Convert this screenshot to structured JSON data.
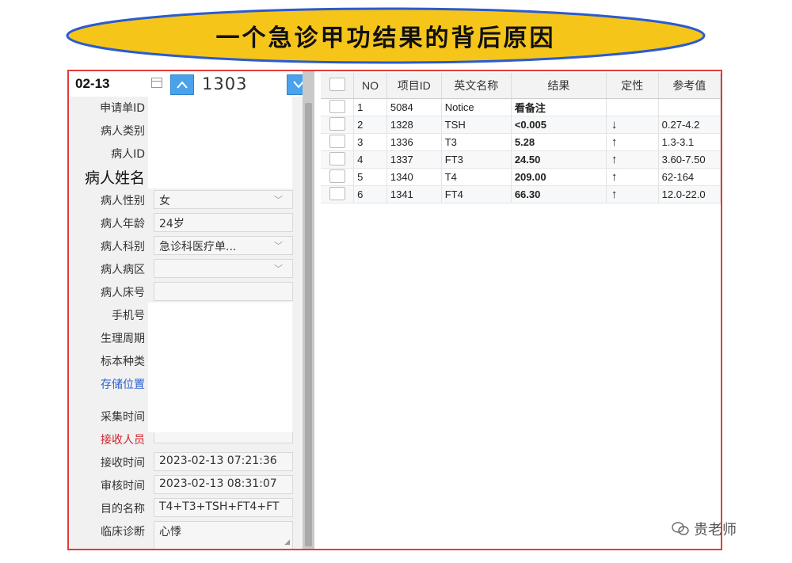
{
  "banner": {
    "title": "一个急诊甲功结果的背后原因"
  },
  "toolbar": {
    "date": "02-13",
    "sequence": "1303"
  },
  "form": {
    "application_id": "申请单ID",
    "patient_type": "病人类别",
    "patient_id": "病人ID",
    "patient_name": "病人姓名",
    "gender_label": "病人性别",
    "gender_value": "女",
    "age_label": "病人年龄",
    "age_value": "24岁",
    "dept_label": "病人科别",
    "dept_value": "急诊科医疗单...",
    "ward_label": "病人病区",
    "bed_label": "病人床号",
    "phone_label": "手机号",
    "cycle_label": "生理周期",
    "sample_label": "标本种类",
    "storage_label": "存储位置",
    "collect_label": "采集时间",
    "receiver_label": "接收人员",
    "receive_time_label": "接收时间",
    "receive_time_value": "2023-02-13 07:21:36",
    "review_time_label": "审核时间",
    "review_time_value": "2023-02-13 08:31:07",
    "purpose_label": "目的名称",
    "purpose_value": "T4+T3+TSH+FT4+FT",
    "diagnosis_label": "临床诊断",
    "diagnosis_value": "心悸"
  },
  "table": {
    "headers": [
      "NO",
      "项目ID",
      "英文名称",
      "结果",
      "定性",
      "参考值"
    ],
    "rows": [
      {
        "no": "1",
        "id": "5084",
        "name": "Notice",
        "result": "看备注",
        "flag": "",
        "ref": ""
      },
      {
        "no": "2",
        "id": "1328",
        "name": "TSH",
        "result": "<0.005",
        "flag": "↓",
        "ref": "0.27-4.2"
      },
      {
        "no": "3",
        "id": "1336",
        "name": "T3",
        "result": "5.28",
        "flag": "↑",
        "ref": "1.3-3.1"
      },
      {
        "no": "4",
        "id": "1337",
        "name": "FT3",
        "result": "24.50",
        "flag": "↑",
        "ref": "3.60-7.50"
      },
      {
        "no": "5",
        "id": "1340",
        "name": "T4",
        "result": "209.00",
        "flag": "↑",
        "ref": "62-164"
      },
      {
        "no": "6",
        "id": "1341",
        "name": "FT4",
        "result": "66.30",
        "flag": "↑",
        "ref": "12.0-22.0"
      }
    ]
  },
  "watermark": {
    "text": "贵老师"
  },
  "colors": {
    "banner_fill": "#f6c51a",
    "banner_border": "#2a5bd0",
    "window_border": "#e23b3b",
    "accent_blue": "#4aa3ea",
    "high": "#d0202a",
    "low": "#1f5fd0"
  }
}
